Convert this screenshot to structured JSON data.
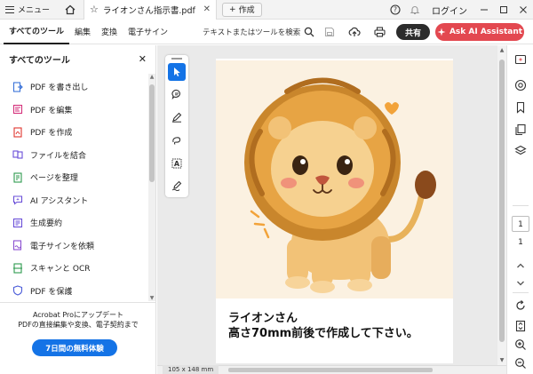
{
  "titlebar": {
    "menu_label": "メニュー",
    "tab_title": "ライオンさん指示書.pdf",
    "create_label": "作成",
    "login_label": "ログイン",
    "icons": [
      "home-icon",
      "star-icon",
      "close-icon",
      "plus-icon",
      "help-icon",
      "bell-icon",
      "minimize-icon",
      "maximize-icon",
      "window-close-icon"
    ]
  },
  "toolbar": {
    "tabs": [
      "すべてのツール",
      "編集",
      "変換",
      "電子サイン"
    ],
    "active_tab": "すべてのツール",
    "search_label": "テキストまたはツールを検索",
    "share_label": "共有",
    "ai_label": "Ask AI Assistant"
  },
  "left_panel": {
    "title": "すべてのツール",
    "items": [
      {
        "label": "PDF を書き出し",
        "icon": "export-pdf-icon",
        "color": "#3a72d8"
      },
      {
        "label": "PDF を編集",
        "icon": "edit-pdf-icon",
        "color": "#d4327c"
      },
      {
        "label": "PDF を作成",
        "icon": "create-pdf-icon",
        "color": "#e0352f"
      },
      {
        "label": "ファイルを結合",
        "icon": "combine-files-icon",
        "color": "#6a4fd8"
      },
      {
        "label": "ページを整理",
        "icon": "organize-pages-icon",
        "color": "#2f9a4f"
      },
      {
        "label": "AI アシスタント",
        "icon": "ai-assistant-icon",
        "color": "#6a4fd8"
      },
      {
        "label": "生成要約",
        "icon": "summary-icon",
        "color": "#6a4fd8"
      },
      {
        "label": "電子サインを依頼",
        "icon": "request-signature-icon",
        "color": "#8a4fd0"
      },
      {
        "label": "スキャンと OCR",
        "icon": "scan-ocr-icon",
        "color": "#2f9a4f"
      },
      {
        "label": "PDF を保護",
        "icon": "protect-pdf-icon",
        "color": "#4a5bd8"
      }
    ],
    "promo_line1": "Acrobat Proにアップデート",
    "promo_line2": "PDFの直接編集や変換、電子契約まで",
    "trial_button": "7日間の無料体験"
  },
  "document": {
    "text_line1": "ライオンさん",
    "text_line2": "高さ70mm前後で作成して下さい。",
    "page_size": "105 x 148 mm"
  },
  "right_rail": {
    "current_page": "1",
    "total_pages": "1"
  },
  "colors": {
    "accent": "#1473e6",
    "ai_button": "#e34850",
    "share_button": "#2c2c2c"
  }
}
